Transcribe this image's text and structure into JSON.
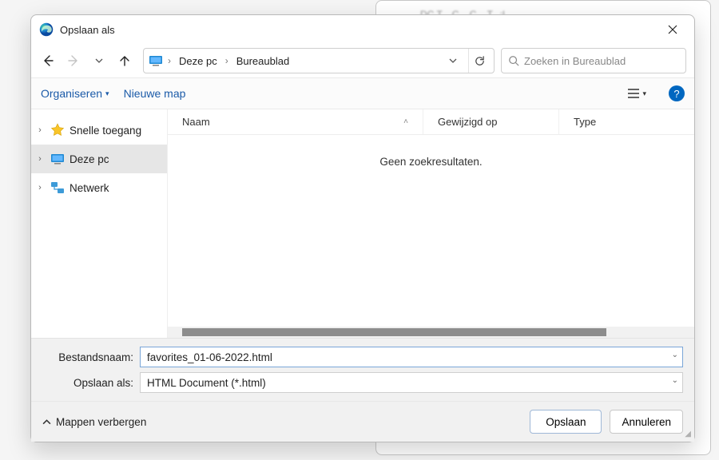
{
  "window": {
    "title": "Opslaan als"
  },
  "nav": {
    "breadcrumb": {
      "root": "Deze pc",
      "folder": "Bureaublad"
    }
  },
  "search": {
    "placeholder": "Zoeken in Bureaublad"
  },
  "toolbar": {
    "organize": "Organiseren",
    "newfolder": "Nieuwe map"
  },
  "tree": {
    "items": [
      {
        "label": "Snelle toegang"
      },
      {
        "label": "Deze pc"
      },
      {
        "label": "Netwerk"
      }
    ]
  },
  "columns": {
    "name": "Naam",
    "modified": "Gewijzigd op",
    "type": "Type"
  },
  "content": {
    "empty": "Geen zoekresultaten."
  },
  "form": {
    "filename_label": "Bestandsnaam:",
    "filename_value": "favorites_01-06-2022.html",
    "type_label": "Opslaan als:",
    "type_value": "HTML Document (*.html)"
  },
  "footer": {
    "hide_folders": "Mappen verbergen",
    "save": "Opslaan",
    "cancel": "Annuleren"
  }
}
